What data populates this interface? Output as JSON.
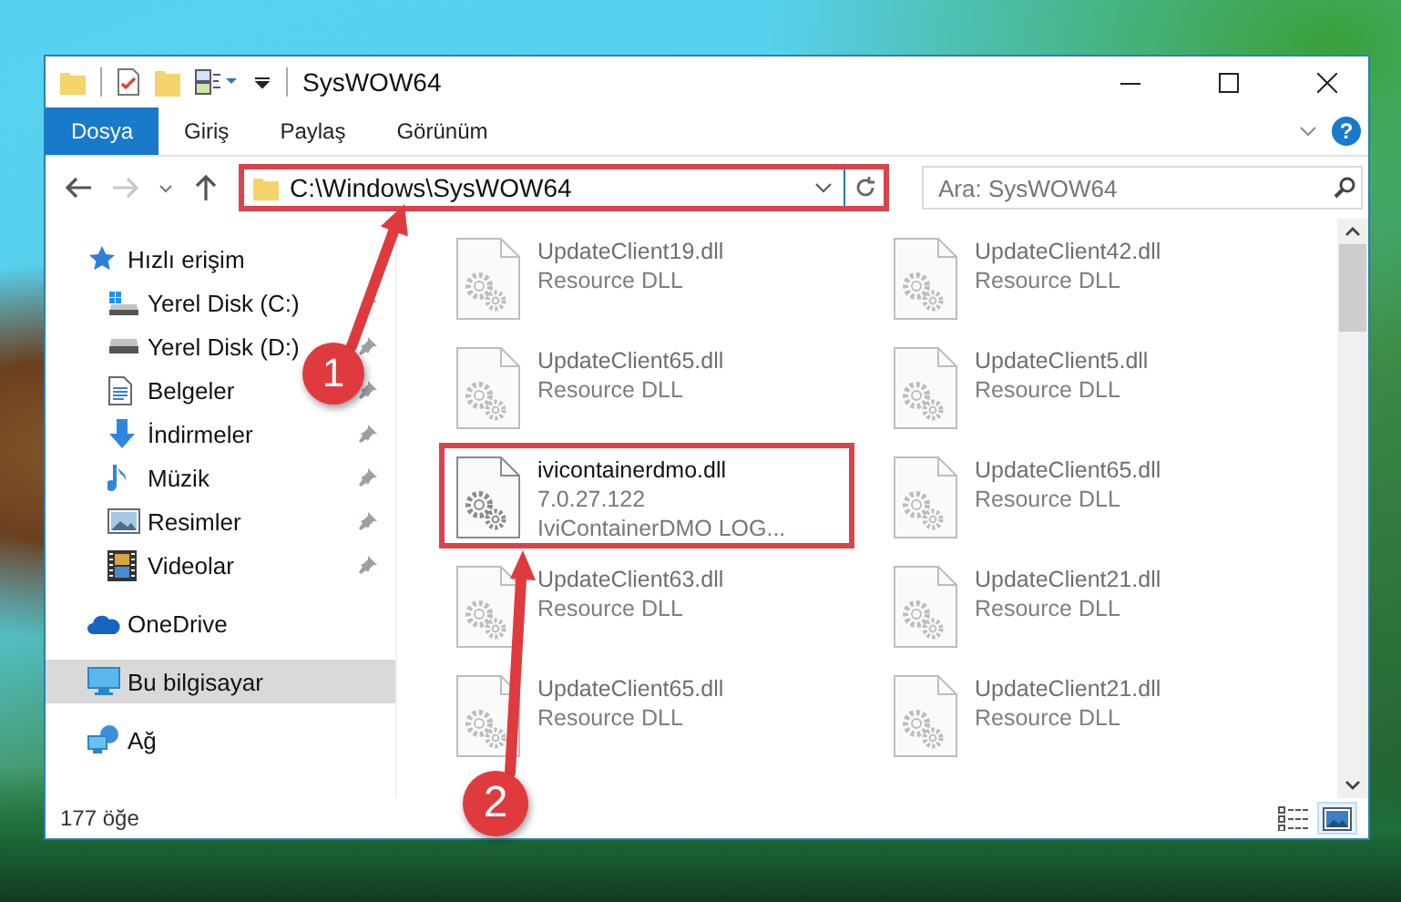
{
  "window": {
    "title": "SysWOW64"
  },
  "ribbon": {
    "tabs": [
      {
        "label": "Dosya",
        "selected": true
      },
      {
        "label": "Giriş",
        "selected": false
      },
      {
        "label": "Paylaş",
        "selected": false
      },
      {
        "label": "Görünüm",
        "selected": false
      }
    ],
    "help": "?"
  },
  "navigation": {
    "back": {
      "disabled": false
    },
    "forward": {
      "disabled": true
    }
  },
  "address_bar": {
    "path": "C:\\Windows\\SysWOW64",
    "highlighted": true
  },
  "search": {
    "placeholder": "Ara: SysWOW64"
  },
  "sidebar": {
    "items": [
      {
        "label": "Hızlı erişim",
        "kind": "quick-access",
        "selected": false,
        "children": [
          {
            "label": "Yerel Disk (C:)",
            "kind": "system-drive",
            "pinned": true,
            "selected": false
          },
          {
            "label": "Yerel Disk (D:)",
            "kind": "drive",
            "pinned": true,
            "selected": false
          },
          {
            "label": "Belgeler",
            "kind": "documents",
            "pinned": true,
            "selected": false
          },
          {
            "label": "İndirmeler",
            "kind": "downloads",
            "pinned": true,
            "selected": false
          },
          {
            "label": "Müzik",
            "kind": "music",
            "pinned": true,
            "selected": false
          },
          {
            "label": "Resimler",
            "kind": "pictures",
            "pinned": true,
            "selected": false
          },
          {
            "label": "Videolar",
            "kind": "videos",
            "pinned": true,
            "selected": false
          }
        ]
      },
      {
        "label": "OneDrive",
        "kind": "cloud",
        "selected": false
      },
      {
        "label": "Bu bilgisayar",
        "kind": "computer",
        "selected": true
      },
      {
        "label": "Ağ",
        "kind": "network",
        "selected": false
      }
    ]
  },
  "files": [
    {
      "name": "UpdateClient19.dll",
      "details": [
        "Resource DLL"
      ],
      "blurred": true,
      "highlighted": false
    },
    {
      "name": "UpdateClient42.dll",
      "details": [
        "Resource DLL"
      ],
      "blurred": true,
      "highlighted": false
    },
    {
      "name": "UpdateClient65.dll",
      "details": [
        "Resource DLL"
      ],
      "blurred": true,
      "highlighted": false
    },
    {
      "name": "UpdateClient5.dll",
      "details": [
        "Resource DLL"
      ],
      "blurred": true,
      "highlighted": false
    },
    {
      "name": "ivicontainerdmo.dll",
      "details": [
        "7.0.27.122",
        "IviContainerDMO LOG..."
      ],
      "blurred": false,
      "highlighted": true
    },
    {
      "name": "UpdateClient65.dll",
      "details": [
        "Resource DLL"
      ],
      "blurred": true,
      "highlighted": false
    },
    {
      "name": "UpdateClient63.dll",
      "details": [
        "Resource DLL"
      ],
      "blurred": true,
      "highlighted": false
    },
    {
      "name": "UpdateClient21.dll",
      "details": [
        "Resource DLL"
      ],
      "blurred": true,
      "highlighted": false
    },
    {
      "name": "UpdateClient65.dll",
      "details": [
        "Resource DLL"
      ],
      "blurred": true,
      "highlighted": false
    },
    {
      "name": "UpdateClient21.dll",
      "details": [
        "Resource DLL"
      ],
      "blurred": true,
      "highlighted": false
    }
  ],
  "status_bar": {
    "item_count": "177 öğe",
    "views": [
      {
        "kind": "details",
        "selected": false
      },
      {
        "kind": "large-icons",
        "selected": true
      }
    ]
  },
  "annotations": [
    {
      "label": "1"
    },
    {
      "label": "2"
    }
  ]
}
